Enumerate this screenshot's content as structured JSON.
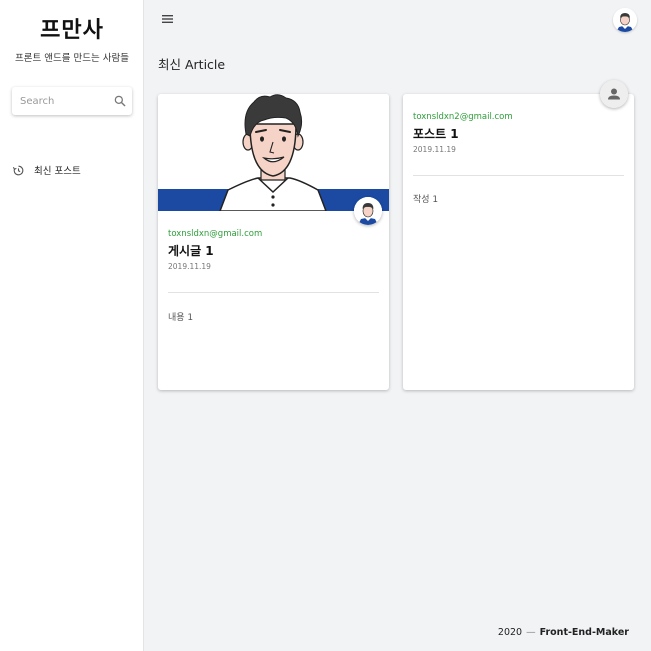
{
  "sidebar": {
    "brand": "프만사",
    "tagline": "프론트 앤드를 만드는 사람들",
    "search": {
      "placeholder": "Search",
      "value": ""
    },
    "items": [
      {
        "label": "최신 포스트",
        "icon": "history-icon"
      }
    ]
  },
  "header": {
    "menu_icon": "hamburger-menu-icon",
    "avatar_icon": "user-avatar"
  },
  "main": {
    "section_title": "최신 Article",
    "cards": [
      {
        "email": "toxnsldxn@gmail.com",
        "title": "게시글 1",
        "date": "2019.11.19",
        "content": "내용 1",
        "has_image": true
      },
      {
        "email": "toxnsldxn2@gmail.com",
        "title": "포스트 1",
        "date": "2019.11.19",
        "content": "작성 1",
        "has_image": false
      }
    ]
  },
  "footer": {
    "year": "2020",
    "separator": "—",
    "name": "Front-End-Maker"
  },
  "colors": {
    "accent_green": "#2e9e3a",
    "banner_blue": "#1c4aa3",
    "background": "#f2f3f5"
  }
}
